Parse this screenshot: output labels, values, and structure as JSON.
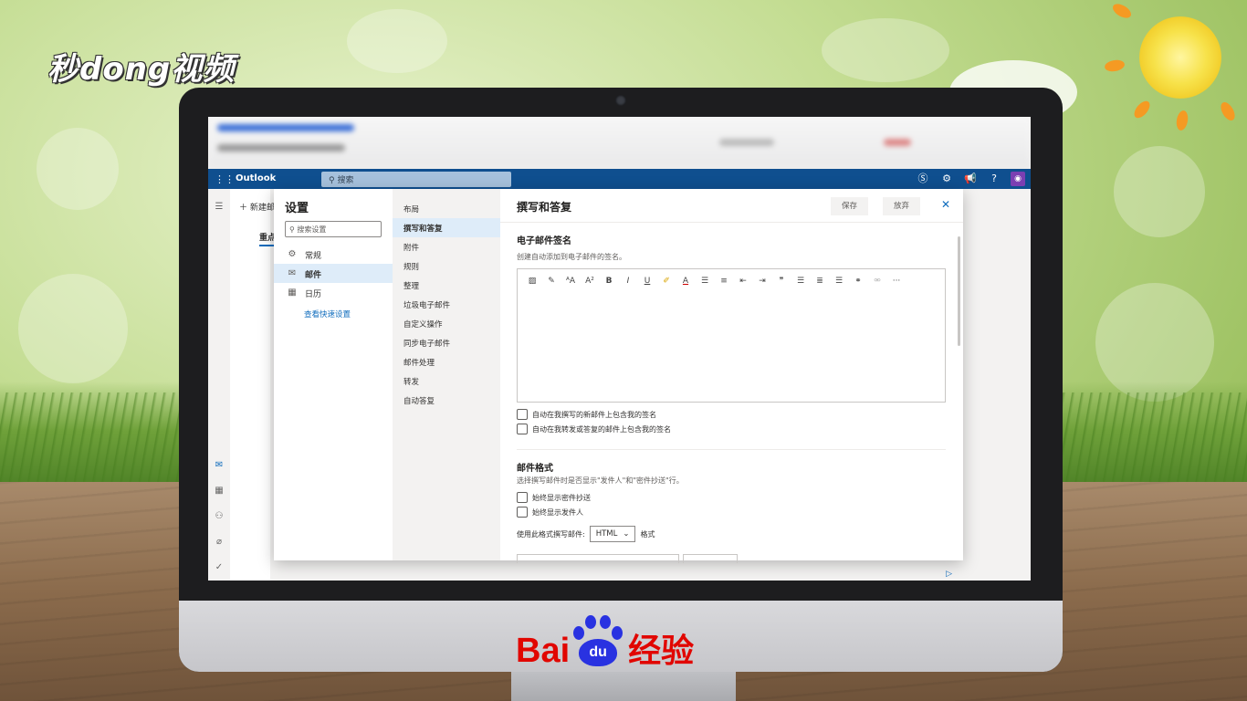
{
  "watermark": {
    "top_left_logo": "秒dong视频",
    "baidu_brand": "Bai",
    "baidu_du": "du",
    "baidu_suffix": "经验"
  },
  "outlook": {
    "brand": "Outlook",
    "search_placeholder": "搜索",
    "new_mail_label": "新建邮",
    "focused_tab": "重点",
    "accent_color": "#0f4f8f"
  },
  "settings": {
    "title": "设置",
    "search_placeholder": "搜索设置",
    "categories": [
      {
        "label": "常规",
        "icon": "gear-icon"
      },
      {
        "label": "邮件",
        "icon": "mail-icon"
      },
      {
        "label": "日历",
        "icon": "calendar-icon"
      }
    ],
    "quick_settings_link": "查看快速设置",
    "subcategories": [
      "布局",
      "撰写和答复",
      "附件",
      "规则",
      "整理",
      "垃圾电子邮件",
      "自定义操作",
      "同步电子邮件",
      "邮件处理",
      "转发",
      "自动答复"
    ],
    "active_subcategory_index": 1
  },
  "panel": {
    "title": "撰写和答复",
    "save_label": "保存",
    "discard_label": "放弃",
    "signature": {
      "title": "电子邮件签名",
      "desc": "创建自动添加到电子邮件的签名。",
      "checkbox_new": "自动在我撰写的新邮件上包含我的签名",
      "checkbox_reply": "自动在我转发或答复的邮件上包含我的签名"
    },
    "format": {
      "title": "邮件格式",
      "desc": "选择撰写邮件时是否显示\"发件人\"和\"密件抄送\"行。",
      "checkbox_bcc": "始终显示密件抄送",
      "checkbox_from": "始终显示发件人",
      "compose_label": "使用此格式撰写邮件:",
      "compose_value": "HTML",
      "compose_suffix": "格式"
    }
  }
}
